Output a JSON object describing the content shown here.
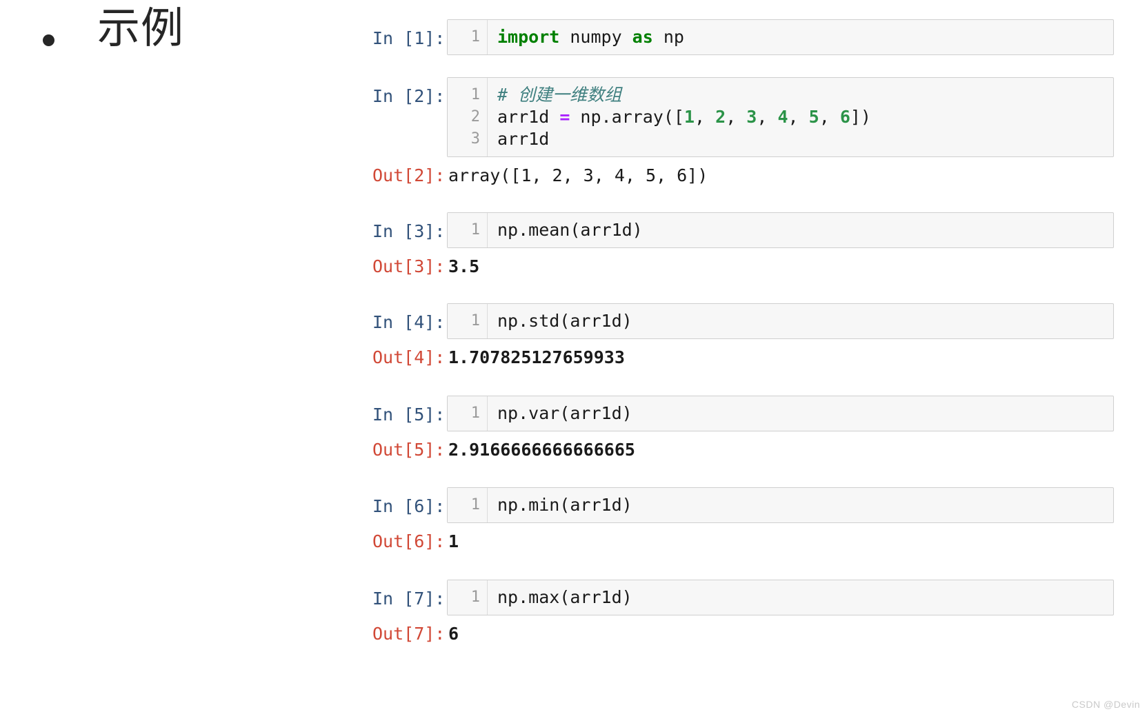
{
  "slide": {
    "bullet_symbol": "•",
    "title": "示例"
  },
  "watermark": "CSDN @Devin",
  "colors": {
    "in_prompt": "#32527a",
    "out_prompt": "#d14836",
    "cell_background": "#f7f7f7",
    "cell_border": "#cfcfcf",
    "gutter_text": "#9a9a9a",
    "keyword": "#008000",
    "comment": "#408080",
    "operator": "#aa22ff",
    "number": "#2b9348",
    "text": "#1a1a1a"
  },
  "notebook": {
    "cells": [
      {
        "in_prompt": "In [1]:",
        "line_numbers": "1",
        "code_tokens": [
          [
            {
              "t": "import",
              "c": "kw"
            },
            {
              "t": " numpy ",
              "c": "plain"
            },
            {
              "t": "as",
              "c": "kw"
            },
            {
              "t": " np",
              "c": "plain"
            }
          ]
        ],
        "out_prompt": null,
        "out_value": null
      },
      {
        "in_prompt": "In [2]:",
        "line_numbers": "1\n2\n3",
        "code_tokens": [
          [
            {
              "t": "# 创建一维数组",
              "c": "comment"
            }
          ],
          [
            {
              "t": "arr1d ",
              "c": "plain"
            },
            {
              "t": "=",
              "c": "op"
            },
            {
              "t": " np.array([",
              "c": "plain"
            },
            {
              "t": "1",
              "c": "num"
            },
            {
              "t": ", ",
              "c": "plain"
            },
            {
              "t": "2",
              "c": "num"
            },
            {
              "t": ", ",
              "c": "plain"
            },
            {
              "t": "3",
              "c": "num"
            },
            {
              "t": ", ",
              "c": "plain"
            },
            {
              "t": "4",
              "c": "num"
            },
            {
              "t": ", ",
              "c": "plain"
            },
            {
              "t": "5",
              "c": "num"
            },
            {
              "t": ", ",
              "c": "plain"
            },
            {
              "t": "6",
              "c": "num"
            },
            {
              "t": "])",
              "c": "plain"
            }
          ],
          [
            {
              "t": "arr1d",
              "c": "plain"
            }
          ]
        ],
        "out_prompt": "Out[2]:",
        "out_value": "array([1, 2, 3, 4, 5, 6])"
      },
      {
        "in_prompt": "In [3]:",
        "line_numbers": "1",
        "code_tokens": [
          [
            {
              "t": "np.mean(arr1d)",
              "c": "plain"
            }
          ]
        ],
        "out_prompt": "Out[3]:",
        "out_value": "3.5"
      },
      {
        "in_prompt": "In [4]:",
        "line_numbers": "1",
        "code_tokens": [
          [
            {
              "t": "np.std(arr1d)",
              "c": "plain"
            }
          ]
        ],
        "out_prompt": "Out[4]:",
        "out_value": "1.707825127659933"
      },
      {
        "in_prompt": "In [5]:",
        "line_numbers": "1",
        "code_tokens": [
          [
            {
              "t": "np.var(arr1d)",
              "c": "plain"
            }
          ]
        ],
        "out_prompt": "Out[5]:",
        "out_value": "2.9166666666666665"
      },
      {
        "in_prompt": "In [6]:",
        "line_numbers": "1",
        "code_tokens": [
          [
            {
              "t": "np.min(arr1d)",
              "c": "plain"
            }
          ]
        ],
        "out_prompt": "Out[6]:",
        "out_value": "1"
      },
      {
        "in_prompt": "In [7]:",
        "line_numbers": "1",
        "code_tokens": [
          [
            {
              "t": "np.max(arr1d)",
              "c": "plain"
            }
          ]
        ],
        "out_prompt": "Out[7]:",
        "out_value": "6"
      }
    ]
  }
}
